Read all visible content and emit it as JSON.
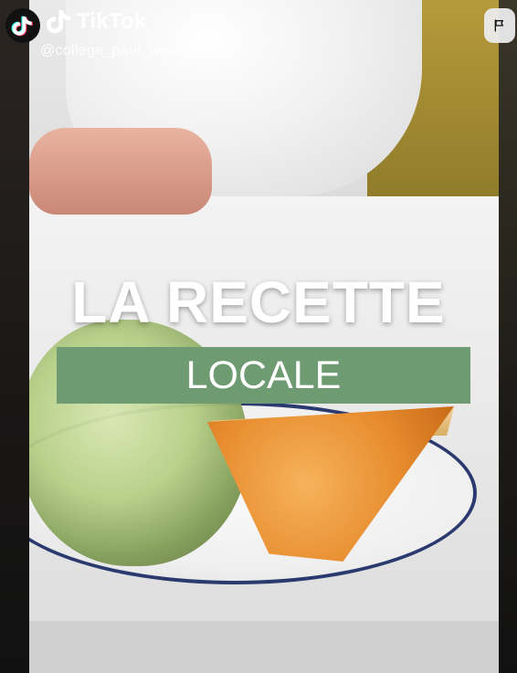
{
  "header": {
    "brand": "TikTok",
    "handle": "@college_paul_wernert"
  },
  "overlay": {
    "title": "LA RECETTE",
    "banner": "LOCALE"
  },
  "icons": {
    "logo": "tiktok-logo-icon",
    "note": "tiktok-note-icon",
    "report": "flag-icon"
  },
  "colors": {
    "banner_green": "#6f9b73",
    "plate_rim": "#2b3a6e"
  }
}
